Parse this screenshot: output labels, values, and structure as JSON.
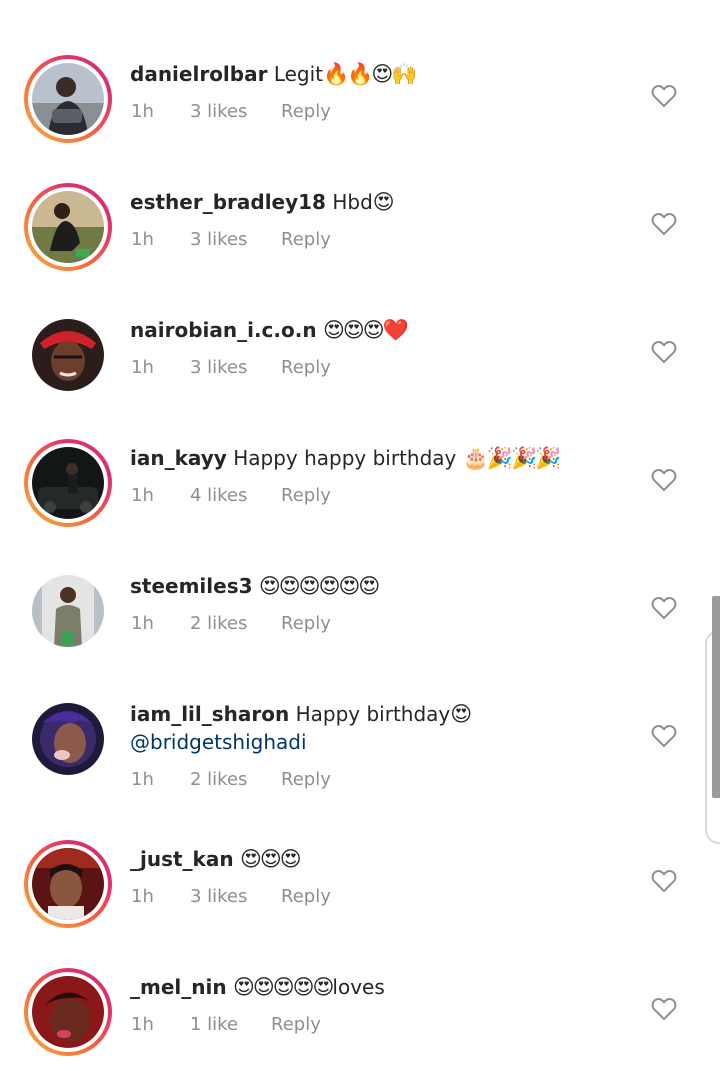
{
  "comments": [
    {
      "username": "danielrolbar",
      "text": "Legit",
      "emojis": "🔥🔥😍🙌",
      "mention": "",
      "time": "1h",
      "likes": "3 likes",
      "reply": "Reply",
      "story_ring": true
    },
    {
      "username": "esther_bradley18",
      "text": "Hbd",
      "emojis": "😍",
      "mention": "",
      "time": "1h",
      "likes": "3 likes",
      "reply": "Reply",
      "story_ring": true
    },
    {
      "username": "nairobian_i.c.o.n",
      "text": "",
      "emojis": "😍😍😍❤️",
      "mention": "",
      "time": "1h",
      "likes": "3 likes",
      "reply": "Reply",
      "story_ring": false
    },
    {
      "username": "ian_kayy",
      "text": "Happy happy birthday",
      "emojis": "🎂🎉🎉🎉",
      "mention": "",
      "time": "1h",
      "likes": "4 likes",
      "reply": "Reply",
      "story_ring": true
    },
    {
      "username": "steemiles3",
      "text": "",
      "emojis": "😍😍😍😍😍😍",
      "mention": "",
      "time": "1h",
      "likes": "2 likes",
      "reply": "Reply",
      "story_ring": false
    },
    {
      "username": "iam_lil_sharon",
      "text": "Happy birthday",
      "emojis": "😍",
      "mention": "@bridgetshighadi",
      "time": "1h",
      "likes": "2 likes",
      "reply": "Reply",
      "story_ring": false
    },
    {
      "username": "_just_kan",
      "text": "",
      "emojis": "😍😍😍",
      "mention": "",
      "time": "1h",
      "likes": "3 likes",
      "reply": "Reply",
      "story_ring": true
    },
    {
      "username": "_mel_nin",
      "text": "",
      "emojis": "😍😍😍😍😍",
      "trailing_text": "loves",
      "mention": "",
      "time": "1h",
      "likes": "1 like",
      "reply": "Reply",
      "story_ring": true
    }
  ],
  "icons": {
    "like": "heart-outline-icon"
  },
  "colors": {
    "username": "#262626",
    "meta": "#8e8e8e",
    "mention": "#00376b",
    "ring_start": "#f9b33a",
    "ring_end": "#c13584"
  }
}
